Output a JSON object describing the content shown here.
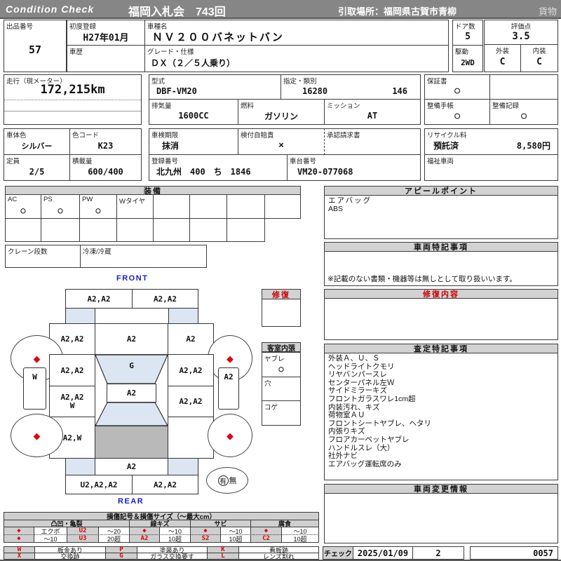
{
  "header": {
    "brand": "Condition  Check",
    "auction": "福岡入札会　743回",
    "pickup": "引取場所：福岡県古賀市青柳",
    "category": "貨物"
  },
  "top": {
    "lot": {
      "label": "出品番号",
      "value": "57"
    },
    "first_reg": {
      "label": "初度登録",
      "value": "H27年01月"
    },
    "history": {
      "label": "車歴",
      "value": ""
    },
    "model": {
      "label": "車種名",
      "value": "ＮＶ２００バネットバン"
    },
    "grade": {
      "label": "グレード・仕様",
      "value": "ＤＸ（２／５人乗り）"
    },
    "doors": {
      "label": "ドア数",
      "value": "5"
    },
    "drive": {
      "label": "駆動",
      "value": "2WD"
    },
    "score": {
      "label": "評価点",
      "value": "3.5"
    },
    "exterior": {
      "label": "外装",
      "value": "C"
    },
    "interior": {
      "label": "内装",
      "value": "C"
    }
  },
  "spec": {
    "mileage": {
      "label": "走行（現メーター）",
      "value": "172,215km"
    },
    "model_code": {
      "label": "型式",
      "value": "DBF-VM20"
    },
    "type_class": {
      "label": "指定・類別",
      "type": "16280",
      "class": "146"
    },
    "warranty": {
      "label": "保証書",
      "value": "○"
    },
    "displacement": {
      "label": "排気量",
      "value": "1600CC"
    },
    "fuel": {
      "label": "燃料",
      "value": "ガソリン"
    },
    "mission": {
      "label": "ミッション",
      "value": "AT"
    },
    "maint_book": {
      "label": "整備手帳",
      "value": "○"
    },
    "maint_record": {
      "label": "整備記録",
      "value": "○"
    },
    "body_color": {
      "label": "車体色",
      "value": "シルバー"
    },
    "color_code": {
      "label": "色コード",
      "value": "K23"
    },
    "inspection": {
      "label": "車検期限",
      "value": "抹消"
    },
    "insurance": {
      "label": "検付自賠責",
      "value": "×"
    },
    "approval": {
      "label": "承認請求書",
      "value": ""
    },
    "recycle": {
      "label": "リサイクル料",
      "status": "預託済",
      "fee": "8,580円"
    },
    "capacity": {
      "label": "定員",
      "value": "2/5"
    },
    "load": {
      "label": "積載量",
      "value": "600/400"
    },
    "reg_no": {
      "label": "登録番号",
      "value": "北九州　400　ち　1846"
    },
    "chassis": {
      "label": "車台番号",
      "value": "VM20-077068"
    },
    "welfare": {
      "label": "福祉車両",
      "value": ""
    }
  },
  "equipment": {
    "title": "装備",
    "cells": [
      {
        "label": "AC",
        "value": "○"
      },
      {
        "label": "PS",
        "value": "○"
      },
      {
        "label": "PW",
        "value": "○"
      },
      {
        "label": "Wタイヤ",
        "value": ""
      }
    ],
    "crane": {
      "label": "クレーン段数",
      "value": ""
    },
    "fridge": {
      "label": "冷凍/冷蔵",
      "value": ""
    }
  },
  "repair_box": {
    "title": "修復"
  },
  "cabin": {
    "title": "客室内張",
    "items": [
      {
        "label": "ヤブレ",
        "value": "○"
      },
      {
        "label": "穴",
        "value": ""
      },
      {
        "label": "コゲ",
        "value": ""
      }
    ]
  },
  "diagram": {
    "front": "FRONT",
    "rear": "REAR",
    "mark": "◆",
    "front_bumper_l": "A2,A2",
    "front_bumper_r": "A2,A2",
    "fender_l": "A2,A2",
    "hood": "A2",
    "fender_r": "A2",
    "door_l": "A2,A2",
    "windshield": "G",
    "door_r": "A2,A2",
    "side_l": "W",
    "side_r": "A2",
    "roof": "A2",
    "slider_l1": "A2,A2",
    "slider_l2": "W",
    "slider_r": "A2,A2",
    "quarter_l": "A2,W",
    "tail": "A2",
    "rear_bumper_l": "U2,A2,A2",
    "rear_bumper_r": "A2,A2",
    "spare_yes": "有",
    "spare_no": "無"
  },
  "appeal": {
    "title": "アピールポイント",
    "lines": [
      "エアバッグ",
      "ABS"
    ]
  },
  "vehicle_notes": {
    "title": "車両特記事項",
    "note": "※記載のない書類・機器等は無しとして取り扱いいます。"
  },
  "repair_content": {
    "title": "修復内容"
  },
  "assessment": {
    "title": "査定特記事項",
    "lines": [
      "外装Ａ、Ｕ、Ｓ",
      "ヘッドライトクモリ",
      "リヤバンパースレ",
      "センターパネル左Ｗ",
      "サイドミラーキズ",
      "フロントガラスワレ1cm超",
      "内装汚れ、キズ",
      "荷物室ＡＵ",
      "フロントシートヤブレ、ヘタリ",
      "内張りキズ",
      "フロアカーペットヤブレ",
      "ハンドルスレ（大）",
      "社外ナビ",
      "エアバッグ運転席のみ"
    ]
  },
  "change_info": {
    "title": "車両変更情報"
  },
  "check": {
    "label": "チェック",
    "date": "2025/01/09",
    "count": "2",
    "number": "0057"
  },
  "legend": {
    "title": "損傷記号＆損傷サイズ（～最大cm）",
    "groups": [
      {
        "name": "凸凹・亀裂",
        "r1": [
          "◆",
          "エクボ",
          "U2",
          "～20"
        ],
        "r2": [
          "◆",
          "～10",
          "U3",
          "20超"
        ]
      },
      {
        "name": "線キズ",
        "r1": [
          "◆",
          "～10"
        ],
        "r2": [
          "A2",
          "10超"
        ]
      },
      {
        "name": "サビ",
        "r1": [
          "◆",
          "～10"
        ],
        "r2": [
          "S2",
          "10超"
        ]
      },
      {
        "name": "腐食",
        "r1": [
          "◆",
          "～10"
        ],
        "r2": [
          "C2",
          "10超"
        ]
      }
    ],
    "symbols": [
      {
        "code": "W",
        "label": "板金あり"
      },
      {
        "code": "P",
        "label": "塗装あり"
      },
      {
        "code": "K",
        "label": "看板跡"
      },
      {
        "code": "X",
        "label": "交換跡"
      },
      {
        "code": "G",
        "label": "ガラス交換要す"
      },
      {
        "code": "L",
        "label": "レンズ割れ"
      }
    ]
  }
}
